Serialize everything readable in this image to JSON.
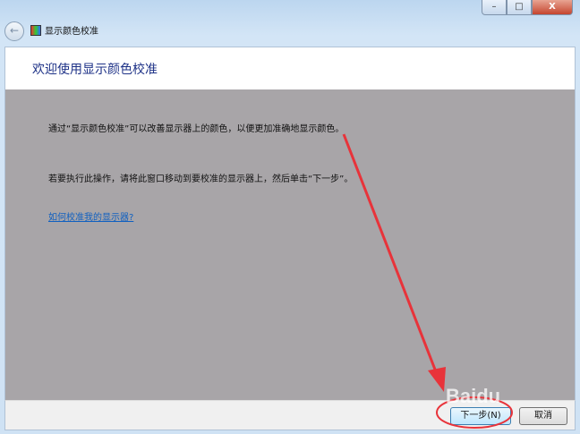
{
  "window": {
    "title": "显示颜色校准",
    "controls": {
      "minimize": "–",
      "maximize": "□",
      "close": "X"
    }
  },
  "header": {
    "title": "欢迎使用显示颜色校准"
  },
  "main": {
    "paragraph1": "通过“显示颜色校准”可以改善显示器上的颜色，以便更加准确地显示颜色。",
    "paragraph2": "若要执行此操作，请将此窗口移动到要校准的显示器上，然后单击“下一步”。",
    "help_link": "如何校准我的显示器?"
  },
  "footer": {
    "next": "下一步(N)",
    "cancel": "取消"
  },
  "watermark": "Baidu",
  "annotation_color": "#e8333a"
}
